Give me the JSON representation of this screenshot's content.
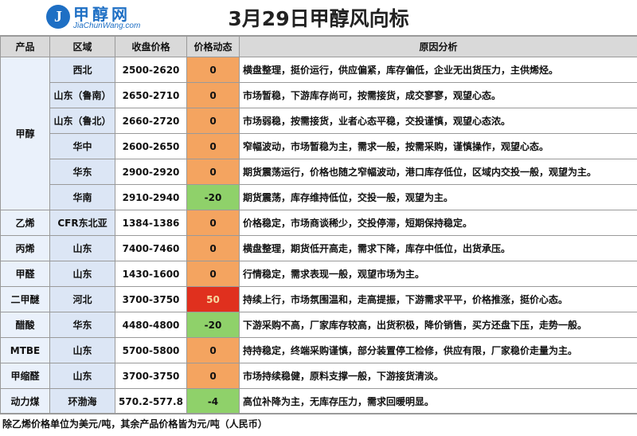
{
  "logo": {
    "mark": "J",
    "cn": "甲醇网",
    "en": "JiaChunWang.com"
  },
  "title": "3月29日甲醇风向标",
  "headers": {
    "product": "产品",
    "region": "区域",
    "price": "收盘价格",
    "change": "价格动态",
    "reason": "原因分析"
  },
  "rows": [
    {
      "product": "甲醇",
      "region": "西北",
      "price": "2500-2620",
      "change": "0",
      "reason": "横盘整理，挺价运行，供应偏紧，库存偏低，企业无出货压力，主供烯烃。"
    },
    {
      "region": "山东（鲁南）",
      "price": "2650-2710",
      "change": "0",
      "reason": "市场暂稳，下游库存尚可，按需接货，成交寥寥，观望心态。"
    },
    {
      "region": "山东（鲁北）",
      "price": "2660-2720",
      "change": "0",
      "reason": "市场弱稳，按需接货，业者心态平稳，交投谨慎，观望心态浓。"
    },
    {
      "region": "华中",
      "price": "2600-2650",
      "change": "0",
      "reason": "窄幅波动，市场暂稳为主，需求一般，按需采购，谨慎操作，观望心态。"
    },
    {
      "region": "华东",
      "price": "2900-2920",
      "change": "0",
      "reason": "期货震荡运行，价格也随之窄幅波动，港口库存低位，区域内交投一般，观望为主。"
    },
    {
      "region": "华南",
      "price": "2910-2940",
      "change": "-20",
      "reason": "期货震荡，库存维持低位，交投一般，观望为主。"
    },
    {
      "product": "乙烯",
      "region": "CFR东北亚",
      "price": "1384-1386",
      "change": "0",
      "reason": "价格稳定，市场商谈稀少，交投停滞，短期保持稳定。"
    },
    {
      "product": "丙烯",
      "region": "山东",
      "price": "7400-7460",
      "change": "0",
      "reason": "横盘整理，期货低开高走，需求下降，库存中低位，出货承压。"
    },
    {
      "product": "甲醛",
      "region": "山东",
      "price": "1430-1600",
      "change": "0",
      "reason": "行情稳定，需求表现一般，观望市场为主。"
    },
    {
      "product": "二甲醚",
      "region": "河北",
      "price": "3700-3750",
      "change": "50",
      "reason": "持续上行，市场氛围温和，走高提振，下游需求平平，价格推涨，挺价心态。"
    },
    {
      "product": "醋酸",
      "region": "华东",
      "price": "4480-4800",
      "change": "-20",
      "reason": "下游采购不高，厂家库存较高，出货积极，降价销售，买方还盘下压，走势一般。"
    },
    {
      "product": "MTBE",
      "region": "山东",
      "price": "5700-5800",
      "change": "0",
      "reason": "持持稳定，终端采购谨慎，部分装置停工检修，供应有限，厂家稳价走量为主。"
    },
    {
      "product": "甲缩醛",
      "region": "山东",
      "price": "3700-3750",
      "change": "0",
      "reason": "市场持续稳健，原料支撑一般，下游接货清淡。"
    },
    {
      "product": "动力煤",
      "region": "环渤海",
      "price": "570.2-577.8",
      "change": "-4",
      "reason": "高位补降为主，无库存压力，需求回暖明显。"
    }
  ],
  "footer": "除乙烯价格单位为美元/吨，其余产品价格皆为元/吨（人民币）",
  "colors": {
    "zero": "#f4a460",
    "down": "#8fd16a",
    "up": "#e0301e"
  }
}
